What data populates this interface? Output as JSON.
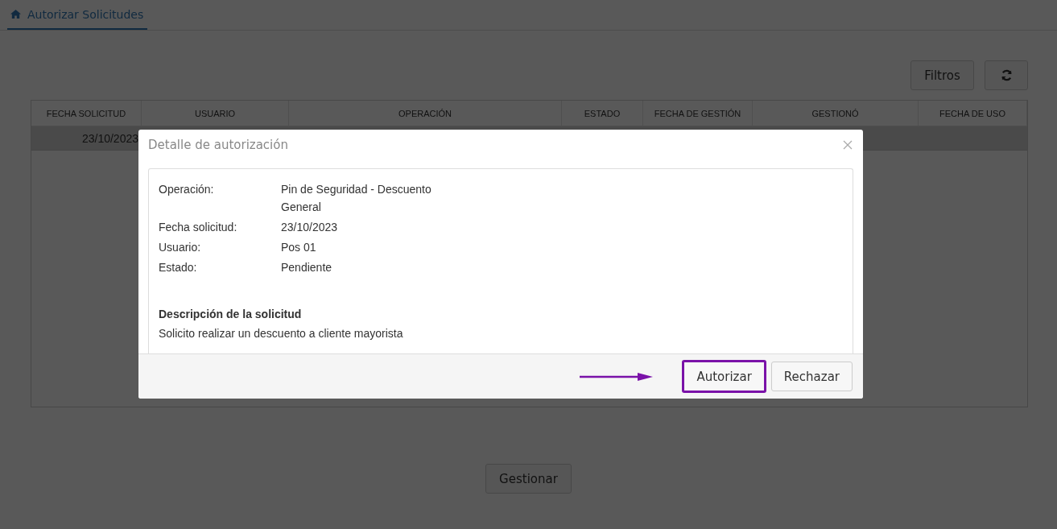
{
  "tab": {
    "label": "Autorizar Solicitudes",
    "selected": true
  },
  "toolbar": {
    "filter_button": "Filtros"
  },
  "table": {
    "columns": [
      "FECHA SOLICITUD",
      "USUARIO",
      "OPERACIÓN",
      "ESTADO",
      "FECHA DE GESTIÓN",
      "GESTIONÓ",
      "FECHA DE USO"
    ],
    "rows": [
      {
        "cells": [
          "23/10/2023"
        ],
        "selected": true
      }
    ]
  },
  "manage_button": "Gestionar",
  "modal": {
    "title": "Detalle de autorización",
    "fields": [
      {
        "label": "Operación:",
        "value": "Pin de Seguridad - Descuento General"
      },
      {
        "label": "Fecha solicitud:",
        "value": "23/10/2023"
      },
      {
        "label": "Usuario:",
        "value": "Pos 01"
      },
      {
        "label": "Estado:",
        "value": "Pendiente"
      }
    ],
    "description_heading": "Descripción de la solicitud",
    "description": "Solicito realizar un descuento a cliente mayorista",
    "buttons": [
      {
        "label": "Autorizar",
        "highlighted": true
      },
      {
        "label": "Rechazar",
        "highlighted": false
      }
    ]
  }
}
